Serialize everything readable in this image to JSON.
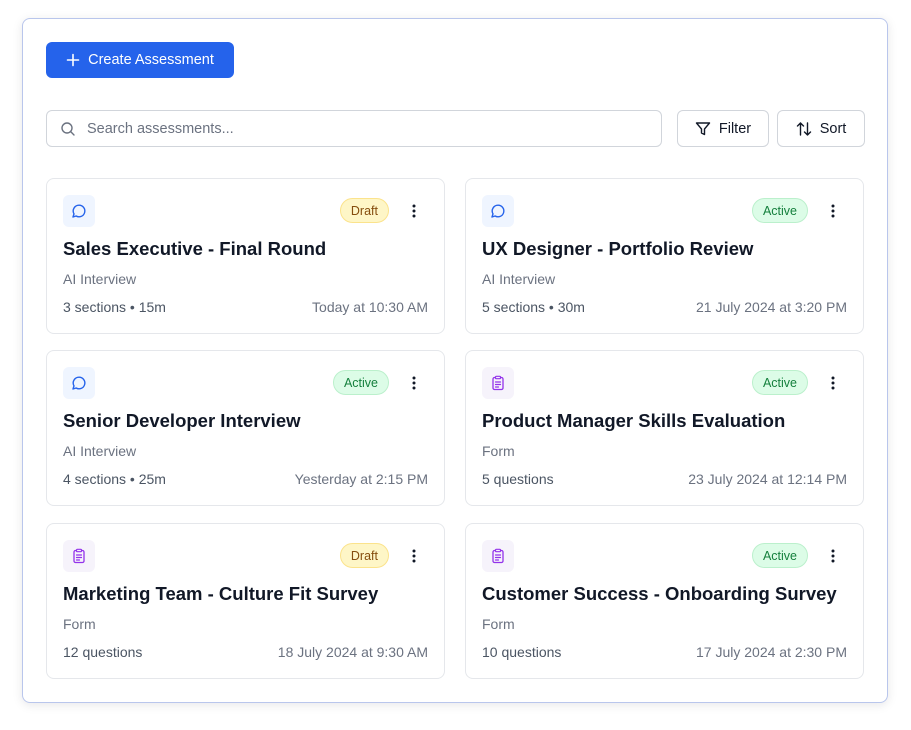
{
  "toolbar": {
    "create_label": "Create Assessment",
    "search_placeholder": "Search assessments...",
    "filter_label": "Filter",
    "sort_label": "Sort"
  },
  "assessments": [
    {
      "title": "Sales Executive - Final Round",
      "kind": "AI Interview",
      "icon": "chat-bubble-icon",
      "status": "Draft",
      "meta": "3 sections • 15m",
      "time": "Today at 10:30 AM"
    },
    {
      "title": "UX Designer - Portfolio Review",
      "kind": "AI Interview",
      "icon": "chat-bubble-icon",
      "status": "Active",
      "meta": "5 sections • 30m",
      "time": "21 July 2024 at 3:20 PM"
    },
    {
      "title": "Senior Developer Interview",
      "kind": "AI Interview",
      "icon": "chat-bubble-icon",
      "status": "Active",
      "meta": "4 sections • 25m",
      "time": "Yesterday at 2:15 PM"
    },
    {
      "title": "Product Manager Skills Evaluation",
      "kind": "Form",
      "icon": "clipboard-list-icon",
      "status": "Active",
      "meta": "5 questions",
      "time": "23 July 2024 at 12:14 PM"
    },
    {
      "title": "Marketing Team - Culture Fit Survey",
      "kind": "Form",
      "icon": "clipboard-list-icon",
      "status": "Draft",
      "meta": "12 questions",
      "time": "18 July 2024 at 9:30 AM"
    },
    {
      "title": "Customer Success - Onboarding Survey",
      "kind": "Form",
      "icon": "clipboard-list-icon",
      "status": "Active",
      "meta": "10 questions",
      "time": "17 July 2024 at 2:30 PM"
    }
  ],
  "colors": {
    "primary": "#2563eb",
    "chat_icon": "#2563eb",
    "form_icon": "#9333ea",
    "draft_bg": "#fef6c7",
    "draft_text": "#854d0e",
    "active_bg": "#dcfce7",
    "active_text": "#15803d"
  }
}
